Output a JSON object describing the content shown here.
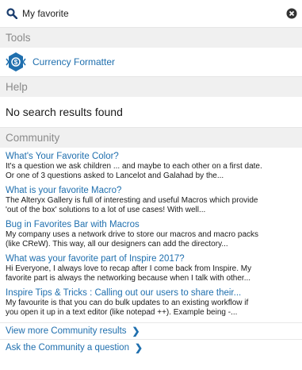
{
  "search": {
    "value": "My favorite"
  },
  "sections": {
    "tools": "Tools",
    "help": "Help",
    "community": "Community"
  },
  "tools": [
    {
      "label": "Currency Formatter",
      "icon": "currency-formatter-icon"
    }
  ],
  "help": {
    "message": "No search results found"
  },
  "community": {
    "results": [
      {
        "title": "What's Your Favorite Color?",
        "line1": "It's a question we ask children ... and maybe to each other on a first date.",
        "line2": "Or one of 3 questions asked to Lancelot and Galahad by the..."
      },
      {
        "title": "What is your favorite Macro?",
        "line1": "The Alteryx Gallery is full of interesting and useful Macros which provide",
        "line2": "'out of the box' solutions to a lot of use cases! With well..."
      },
      {
        "title": "Bug in Favorites Bar with Macros",
        "line1": "My company uses a network drive to store our macros and macro packs",
        "line2": "(like CReW). This way, all our designers can add the directory..."
      },
      {
        "title": "What was your favorite part of Inspire 2017?",
        "line1": "Hi Everyone, I always love to recap after I come back from Inspire. My",
        "line2": "favorite part is always the networking because when I talk with other..."
      },
      {
        "title": "Inspire Tips & Tricks : Calling out our users to share their...",
        "line1": "My favourite is that you can do bulk updates to an existing workflow if",
        "line2": "you open it up in a text editor (like notepad ++). Example being -..."
      }
    ],
    "view_more": "View more Community results",
    "ask": "Ask the Community a question"
  },
  "colors": {
    "link": "#1f6fae",
    "section_bg": "#f0f0f0",
    "badge": "#1f6fae"
  }
}
